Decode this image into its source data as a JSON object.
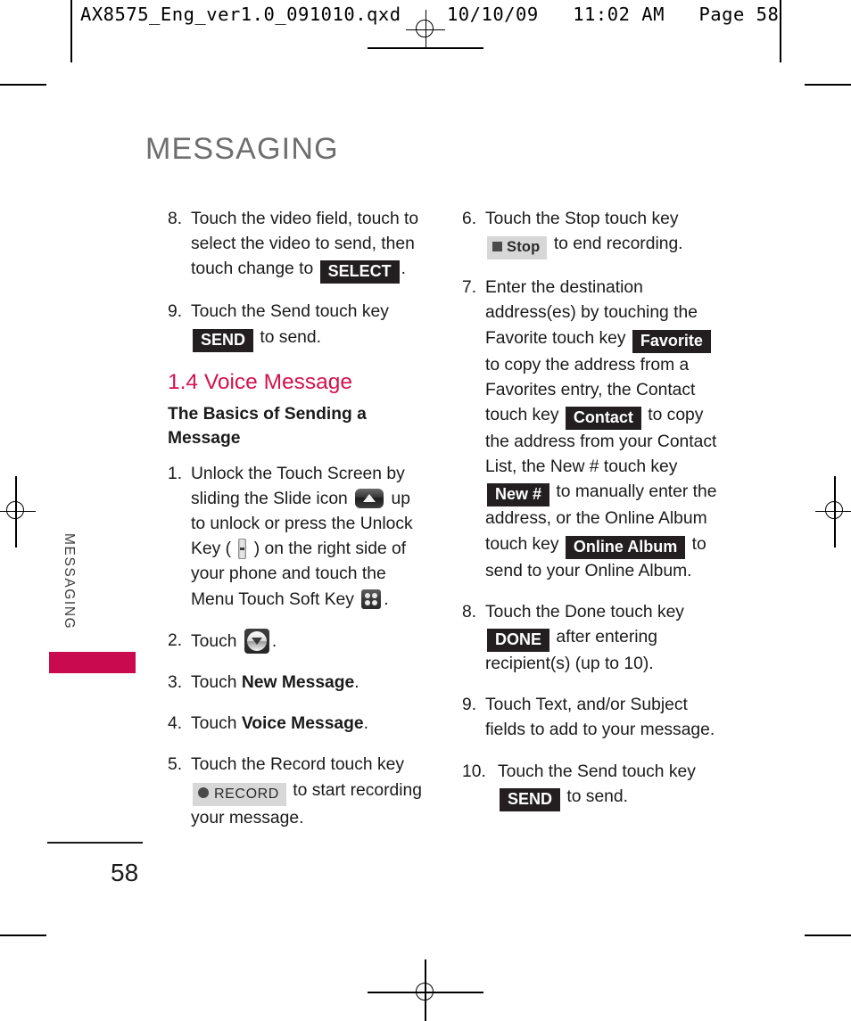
{
  "print_header": {
    "text": "AX8575_Eng_ver1.0_091010.qxd    10/10/09   11:02 AM   Page 58"
  },
  "chapter": {
    "title": "MESSAGING",
    "side_tab_label": "MESSAGING",
    "side_tab_color": "#ca0a4e",
    "title_color": "#6e6e6e"
  },
  "folio": {
    "page_number": "58"
  },
  "section": {
    "number": "1.4",
    "title": "Voice Message",
    "accent_color": "#d3124f",
    "subtitle": "The Basics of Sending a Message"
  },
  "keys": {
    "select": "SELECT",
    "send": "SEND",
    "record": "RECORD",
    "stop": "Stop",
    "favorite": "Favorite",
    "contact": "Contact",
    "new_number": "New #",
    "online_album": "Online Album",
    "done": "DONE"
  },
  "icons": {
    "slide": "slide-up-icon",
    "unlock_key": "unlock-key-icon",
    "menu_soft_key": "menu-touch-soft-key-icon",
    "message_menu": "message-menu-icon"
  },
  "left_column": {
    "steps": [
      {
        "num": "8.",
        "text_before": "Touch the video field, touch to select the video to send, then touch change to ",
        "chip": "SELECT",
        "text_after": "."
      },
      {
        "num": "9.",
        "text_before": "Touch the Send touch key ",
        "chip": "SEND",
        "text_after": " to send."
      }
    ],
    "steps2": [
      {
        "num": "1.",
        "seg1": "Unlock the Touch Screen by sliding the Slide icon ",
        "seg2": " up to unlock or press the Unlock Key ( ",
        "seg3": " ) on the right side of your phone and touch the Menu Touch Soft Key ",
        "seg4": "."
      },
      {
        "num": "2.",
        "seg1": "Touch ",
        "seg2": "."
      },
      {
        "num": "3.",
        "seg1": "Touch ",
        "bold": "New Message",
        "seg2": "."
      },
      {
        "num": "4.",
        "seg1": "Touch ",
        "bold": "Voice Message",
        "seg2": "."
      },
      {
        "num": "5.",
        "seg1": "Touch the Record touch key ",
        "chip": "RECORD",
        "seg2": " to start recording your message."
      }
    ]
  },
  "right_column": {
    "steps": [
      {
        "num": "6.",
        "seg1": "Touch the Stop touch key ",
        "chip": "Stop",
        "seg2": " to end recording."
      },
      {
        "num": "7.",
        "seg1": "Enter the destination address(es) by touching the Favorite touch key ",
        "chip1": "Favorite",
        "seg2": " to copy the address from a Favorites entry, the Contact touch key ",
        "chip2": "Contact",
        "seg3": " to copy the address from your Contact List, the New # touch key ",
        "chip3": "New #",
        "seg4": " to manually enter the address, or the Online Album touch key ",
        "chip4": "Online Album",
        "seg5": " to send to your Online Album."
      },
      {
        "num": "8.",
        "seg1": "Touch the Done touch key ",
        "chip": "DONE",
        "seg2": " after entering recipient(s) (up to 10)."
      },
      {
        "num": "9.",
        "seg1": "Touch Text, and/or Subject fields to add to your message."
      },
      {
        "num": "10.",
        "seg1": "Touch the Send touch key ",
        "chip": "SEND",
        "seg2": " to send."
      }
    ]
  }
}
